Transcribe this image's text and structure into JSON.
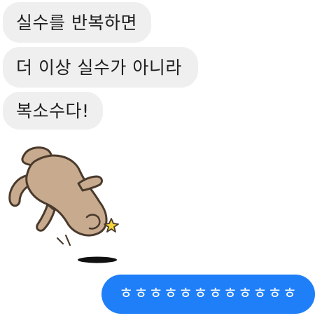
{
  "chat": {
    "messages": [
      {
        "direction": "incoming",
        "text": "실수를 반복하면"
      },
      {
        "direction": "incoming",
        "text": "더 이상 실수가 아니라"
      },
      {
        "direction": "incoming",
        "text": "복소수다!"
      },
      {
        "direction": "incoming",
        "type": "sticker",
        "icon": "falling-cat-sticker"
      },
      {
        "direction": "outgoing",
        "text": "ㅎㅎㅎㅎㅎㅎㅎㅎㅎㅎㅎㅎ"
      }
    ]
  },
  "colors": {
    "incoming_bubble": "#efefef",
    "outgoing_bubble": "#1f7ff8",
    "incoming_text": "#202020",
    "outgoing_text": "#ffffff",
    "background": "#ffffff",
    "sticker_body": "#c8ab8f",
    "sticker_outline": "#4a3a2c"
  }
}
